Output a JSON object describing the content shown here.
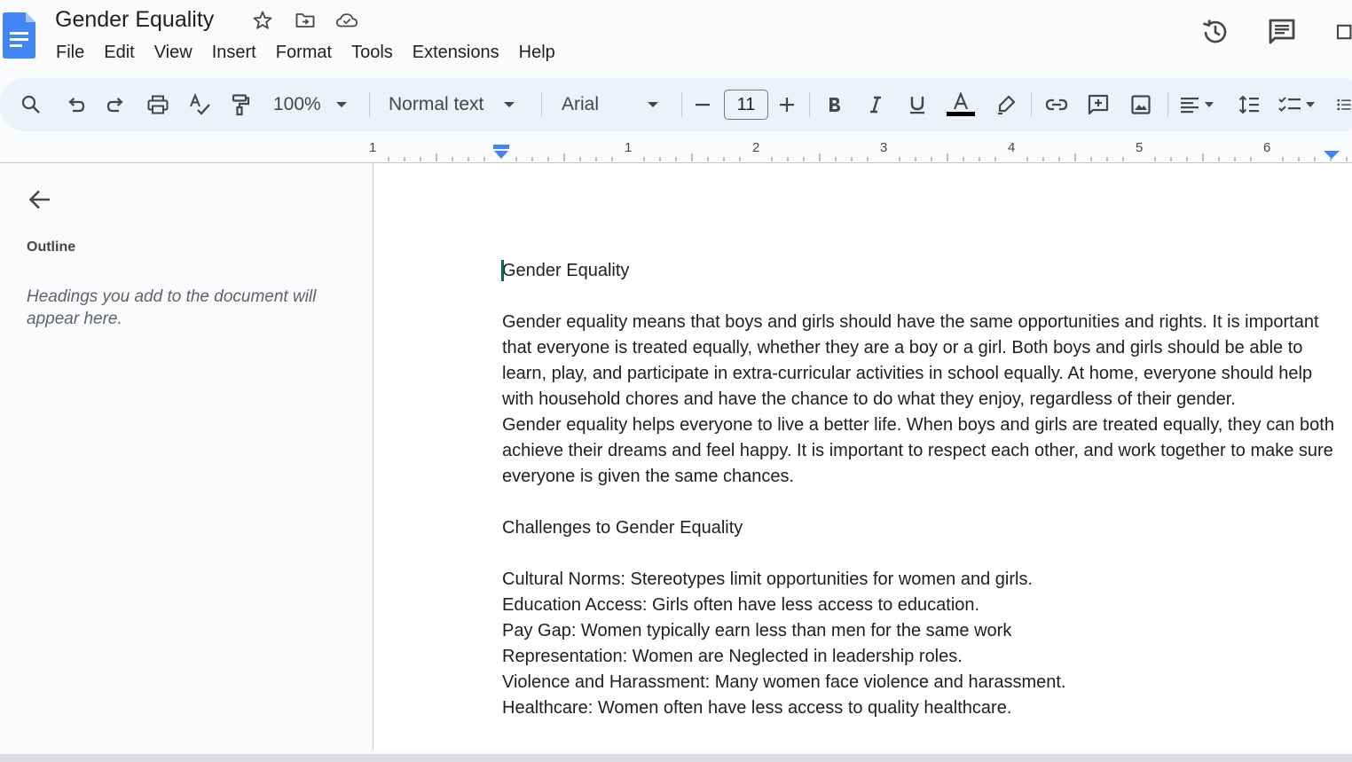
{
  "header": {
    "title": "Gender Equality",
    "menus": [
      "File",
      "Edit",
      "View",
      "Insert",
      "Format",
      "Tools",
      "Extensions",
      "Help"
    ]
  },
  "toolbar": {
    "zoom": "100%",
    "style": "Normal text",
    "font": "Arial",
    "font_size": "11"
  },
  "ruler": {
    "numbers": [
      "1",
      "1",
      "2",
      "3",
      "4",
      "5",
      "6"
    ]
  },
  "outline": {
    "title": "Outline",
    "empty_text": "Headings you add to the document will appear here."
  },
  "document": {
    "heading": "Gender Equality",
    "para1": "Gender equality means that boys and girls should have the same opportunities and rights. It is important that everyone is treated equally, whether they are a boy or a girl. Both boys and girls should be able to learn, play, and participate in extra-curricular activities in school equally. At home, everyone should help with household chores and have the chance to do what they enjoy, regardless of their gender.",
    "para2": "Gender equality helps everyone to live a better life. When boys and girls are treated equally, they can both achieve their dreams and feel happy. It is important to respect each other, and work together to make sure everyone is given the same chances.",
    "subheading": "Challenges to Gender Equality",
    "items": [
      "Cultural Norms: Stereotypes limit opportunities for women and girls.",
      "Education Access: Girls often have less access to education.",
      "Pay Gap: Women typically earn less than men for the same work",
      "Representation: Women are Neglected in leadership roles.",
      "Violence and Harassment: Many women face violence and harassment.",
      "Healthcare: Women often have less access to quality healthcare."
    ]
  },
  "colors": {
    "brand_blue": "#4285f4",
    "toolbar_bg": "#edf2fa",
    "cursor": "#0b6b3a"
  }
}
